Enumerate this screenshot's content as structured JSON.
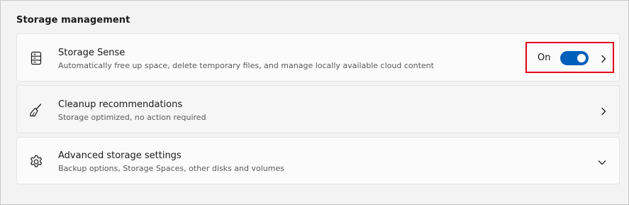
{
  "section": {
    "title": "Storage management"
  },
  "items": [
    {
      "title": "Storage Sense",
      "description": "Automatically free up space, delete temporary files, and manage locally available cloud content",
      "icon": "storage-drive-icon",
      "toggle_label": "On",
      "toggle_on": true,
      "action": "chevron-right-icon"
    },
    {
      "title": "Cleanup recommendations",
      "description": "Storage optimized, no action required",
      "icon": "broom-icon",
      "action": "chevron-right-icon"
    },
    {
      "title": "Advanced storage settings",
      "description": "Backup options, Storage Spaces, other disks and volumes",
      "icon": "gear-icon",
      "action": "chevron-down-icon"
    }
  ],
  "colors": {
    "accent": "#005fb8",
    "highlight": "#e0001b"
  }
}
